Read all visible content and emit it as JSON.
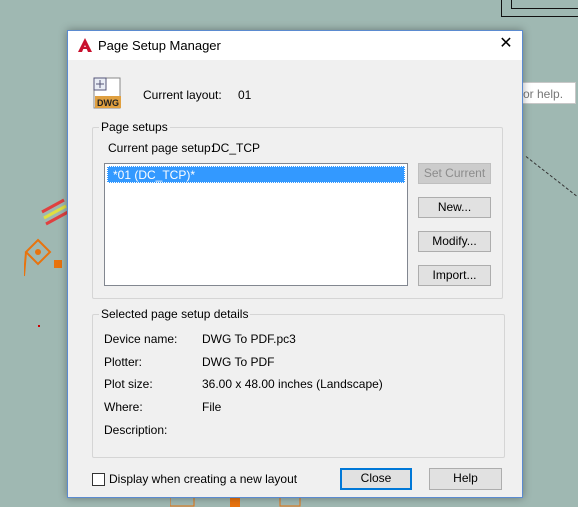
{
  "background": {
    "help_hint": "or help."
  },
  "dialog": {
    "title": "Page Setup Manager",
    "current_layout_label": "Current layout:",
    "current_layout_value": "01",
    "page_setups": {
      "legend": "Page setups",
      "current_page_setup_label": "Current page setup:",
      "current_page_setup_value": "DC_TCP",
      "list_items": [
        "*01 (DC_TCP)*"
      ],
      "buttons": {
        "set_current": "Set Current",
        "new": "New...",
        "modify": "Modify...",
        "import": "Import..."
      }
    },
    "details": {
      "legend": "Selected page setup details",
      "rows": [
        {
          "label": "Device name:",
          "value": "DWG To PDF.pc3"
        },
        {
          "label": "Plotter:",
          "value": "DWG To PDF"
        },
        {
          "label": "Plot size:",
          "value": "36.00 x 48.00 inches (Landscape)"
        },
        {
          "label": "Where:",
          "value": "File"
        },
        {
          "label": "Description:",
          "value": ""
        }
      ]
    },
    "checkbox_label": "Display when creating a new layout",
    "close_label": "Close",
    "help_label": "Help"
  }
}
